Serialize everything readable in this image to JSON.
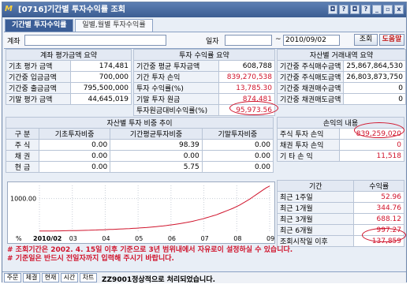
{
  "window": {
    "title": "[0716]기간별 투자수익률 조회",
    "logo": "M"
  },
  "title_buttons": [
    "◘",
    "?",
    "◘",
    "?",
    "_",
    "▫",
    "x"
  ],
  "tabs": [
    "기간별 투자수익률",
    "일별,월별 투자수익률"
  ],
  "filter": {
    "account_label": "계좌",
    "date_label": "일자",
    "date_from": "",
    "date_sep": "~",
    "date_to": "2010/09/02",
    "query_button": "조회",
    "help_button": "도움말"
  },
  "account_summary": {
    "header": "계좌 평가금액 요약",
    "rows": [
      {
        "label": "기초 평가 금액",
        "value": "174,481"
      },
      {
        "label": "기간중 입금금액",
        "value": "700,000"
      },
      {
        "label": "기간중 출금금액",
        "value": "795,500,000"
      },
      {
        "label": "기말 평가 금액",
        "value": "44,645,019"
      }
    ]
  },
  "return_summary": {
    "header": "투자 수익률 요약",
    "rows": [
      {
        "label": "기간중 평균 투자금액",
        "value": "608,788"
      },
      {
        "label": "기간 투자 손익",
        "value": "839,270,538"
      },
      {
        "label": "투자 수익률(%)",
        "value": "13,785.30"
      },
      {
        "label": "기말 투자 원금",
        "value": "874,481"
      },
      {
        "label": "투자원금대비수익률(%)",
        "value": "95,973.56"
      }
    ]
  },
  "asset_trades": {
    "header": "자산별 거래내역 요약",
    "rows": [
      {
        "label": "기간중 주식매수금액",
        "value": "25,867,864,530"
      },
      {
        "label": "기간중 주식매도금액",
        "value": "26,803,873,750"
      },
      {
        "label": "기간중 채권매수금액",
        "value": "0"
      },
      {
        "label": "기간중 채권매도금액",
        "value": "0"
      }
    ]
  },
  "asset_ratio": {
    "header": "자산별 투자 비중 추이",
    "columns": [
      "구 분",
      "기초투자비중",
      "기간평균투자비중",
      "기말투자비중"
    ],
    "rows": [
      {
        "label": "주 식",
        "base": "0.00",
        "avg": "98.39",
        "end": "0.00"
      },
      {
        "label": "채 권",
        "base": "0.00",
        "avg": "0.00",
        "end": "0.00"
      },
      {
        "label": "현 금",
        "base": "0.00",
        "avg": "5.75",
        "end": "0.00"
      }
    ]
  },
  "pnl": {
    "header": "손익의 내용",
    "rows": [
      {
        "label": "주식 투자 손익",
        "value": "839,259,020"
      },
      {
        "label": "채권 투자 손익",
        "value": "0"
      },
      {
        "label": "기 타 손 익",
        "value": "11,518"
      }
    ]
  },
  "period_returns": {
    "columns": [
      "기간",
      "수익률"
    ],
    "rows": [
      {
        "label": "최근 1주일",
        "value": "52.96"
      },
      {
        "label": "최근 1개월",
        "value": "344.76"
      },
      {
        "label": "최근 3개월",
        "value": "688.12"
      },
      {
        "label": "최근 6개월",
        "value": "997.27"
      },
      {
        "label": "조회시작일 이후",
        "value": "137,859"
      }
    ]
  },
  "chart_data": {
    "type": "line",
    "x_ticks": [
      "2010/02",
      "03",
      "04",
      "05",
      "06",
      "07",
      "08",
      "09"
    ],
    "y_ticks": [
      "1000.00",
      "%"
    ],
    "ylim": [
      0,
      1400
    ],
    "values": [
      5,
      6,
      6,
      7,
      8,
      9,
      10,
      12,
      14,
      16,
      18,
      20,
      22,
      24,
      27,
      30,
      33,
      36,
      40,
      44,
      48,
      52,
      56,
      60,
      65,
      70,
      75,
      80,
      86,
      92,
      98,
      105,
      112,
      120,
      130,
      140,
      150,
      160,
      172,
      185,
      200,
      215,
      230,
      248,
      265,
      285,
      305,
      330,
      355,
      380,
      410,
      440,
      470,
      500,
      540,
      580,
      620,
      660,
      700,
      750,
      800,
      860,
      920,
      980,
      1050,
      1120,
      1190,
      1260,
      1330,
      1380
    ]
  },
  "notes": [
    "# 조회기간은 2002. 4. 15일 이후 기준으로 3년 범위내에서 자유로이 설정하실 수 있습니다.",
    "# 기준일은 반드시 전일자까지 입력해 주시기 바랍니다."
  ],
  "statusbar": {
    "buttons": [
      "주문",
      "체결",
      "현재",
      "시간",
      "차트"
    ],
    "message": "ZZ9001정상적으로 처리되었습니다."
  },
  "colors": {
    "highlight": "#d0142c",
    "title_bar": "#3b5d92"
  }
}
